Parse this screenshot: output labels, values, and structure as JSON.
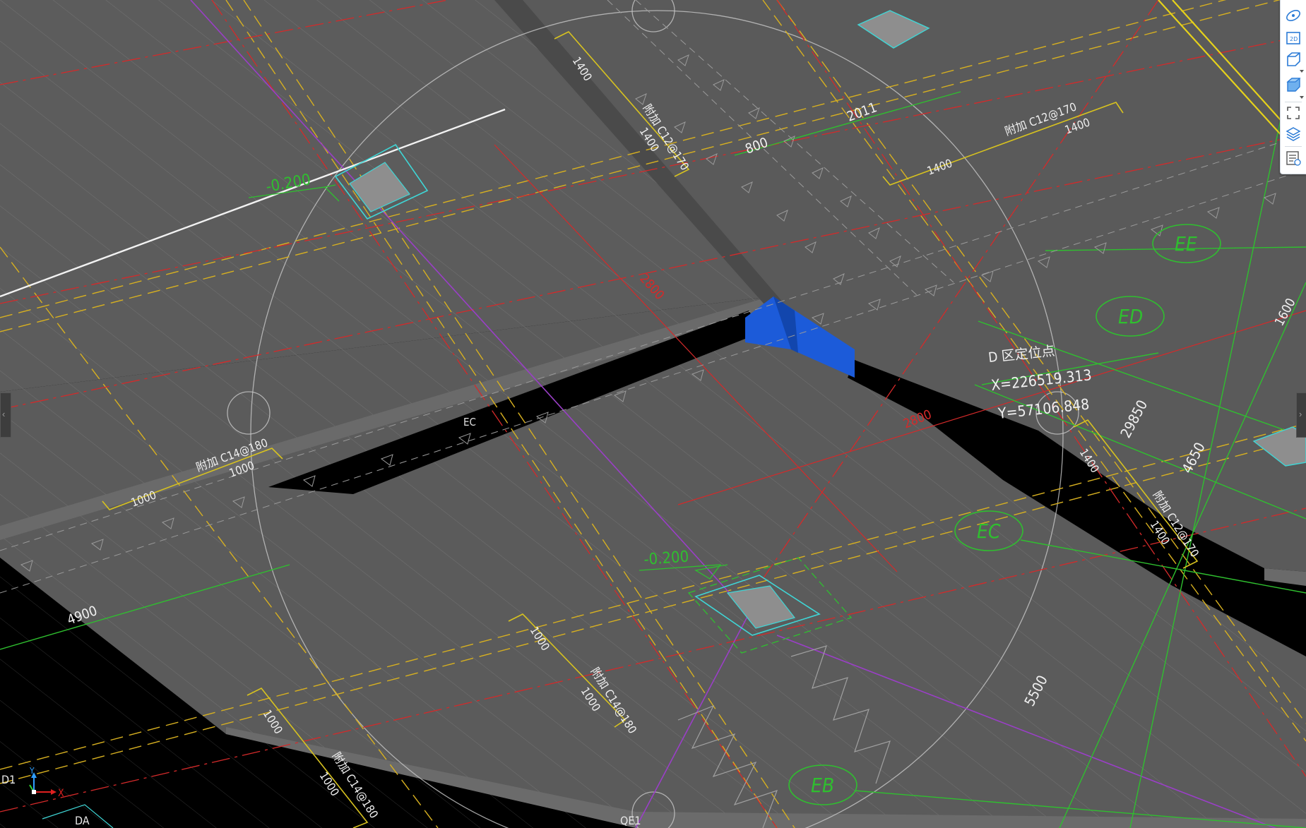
{
  "colors": {
    "background": "#000000",
    "slab": "#5b5b5b",
    "slab_edge": "#6a6a6a",
    "hatch": "#8a8a8a",
    "axis_red": "#d42a2a",
    "axis_yellow": "#d7b020",
    "purple": "#9a3fc7",
    "green": "#2fbf2f",
    "cyan": "#3fd6d6",
    "blue_highlight": "#1c5bd9",
    "white_line": "#f2f2f2",
    "circle": "#c8c8c8"
  },
  "labels": {
    "locate_title": "D 区定位点",
    "locate_x": "X=226519.313",
    "locate_y": "Y=57106.848",
    "elev_1": "-0.200",
    "elev_2": "-0.200",
    "rebar_1": "附加 C12@170",
    "rebar_2": "附加 C12@170",
    "rebar_3": "附加 C14@180",
    "rebar_4": "附加 C14@180",
    "rebar_5": "附加 C14@180",
    "rebar_6": "附加 C12@170",
    "dim_1400_a": "1400",
    "dim_1400_b": "1400",
    "dim_1400_c": "1400",
    "dim_1400_d": "1400",
    "dim_1400_e": "1400",
    "dim_1400_f": "1400",
    "dim_2011": "2011",
    "dim_800": "800",
    "dim_1000_a": "1000",
    "dim_1000_b": "1000",
    "dim_1000_c": "1000",
    "dim_1000_d": "1000",
    "dim_1000_e": "1000",
    "dim_1000_f": "1000",
    "dim_4900": "4900",
    "dim_29850": "29850",
    "dim_4650": "4650",
    "dim_5500": "5500",
    "dim_1600": "1600",
    "dim_red_1": "2800",
    "dim_red_2": "2800",
    "axis_EE": "EE",
    "axis_ED": "ED",
    "axis_EC": "EC",
    "axis_EB": "EB",
    "axis_EC_small": "EC",
    "axis_D1": "D1",
    "axis_DA": "DA",
    "axis_QE1": "QE1",
    "ucs_x": "X",
    "ucs_y": "Y"
  },
  "toolbar": {
    "buttons": [
      {
        "name": "orbit-icon"
      },
      {
        "name": "view-2d-icon",
        "label": "2D"
      },
      {
        "name": "view-3d-box-icon"
      },
      {
        "name": "view-shaded-box-icon"
      },
      {
        "name": "fullscreen-icon"
      },
      {
        "name": "layers-icon"
      },
      {
        "name": "properties-icon"
      }
    ]
  }
}
